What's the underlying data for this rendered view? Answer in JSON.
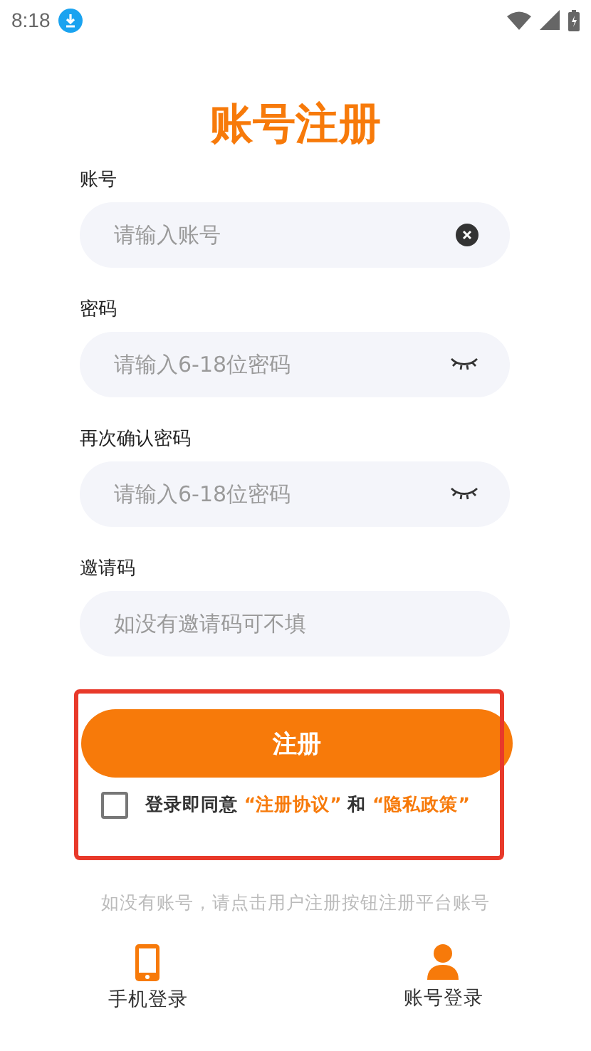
{
  "status_bar": {
    "time": "8:18"
  },
  "title": "账号注册",
  "fields": [
    {
      "label": "账号",
      "placeholder": "请输入账号",
      "kind": "clear"
    },
    {
      "label": "密码",
      "placeholder": "请输入6-18位密码",
      "kind": "eye"
    },
    {
      "label": "再次确认密码",
      "placeholder": "请输入6-18位密码",
      "kind": "eye"
    },
    {
      "label": "邀请码",
      "placeholder": "如没有邀请码可不填",
      "kind": "plain"
    }
  ],
  "register_button": "注册",
  "agreement": {
    "checked": false,
    "prefix": "登录即同意",
    "terms": "“注册协议”",
    "conjunction": "和",
    "privacy": "“隐私政策”"
  },
  "hint": "如没有账号，请点击用户注册按钮注册平台账号",
  "bottom_tabs": [
    {
      "label": "手机登录",
      "kind": "phone"
    },
    {
      "label": "账号登录",
      "kind": "person"
    }
  ]
}
